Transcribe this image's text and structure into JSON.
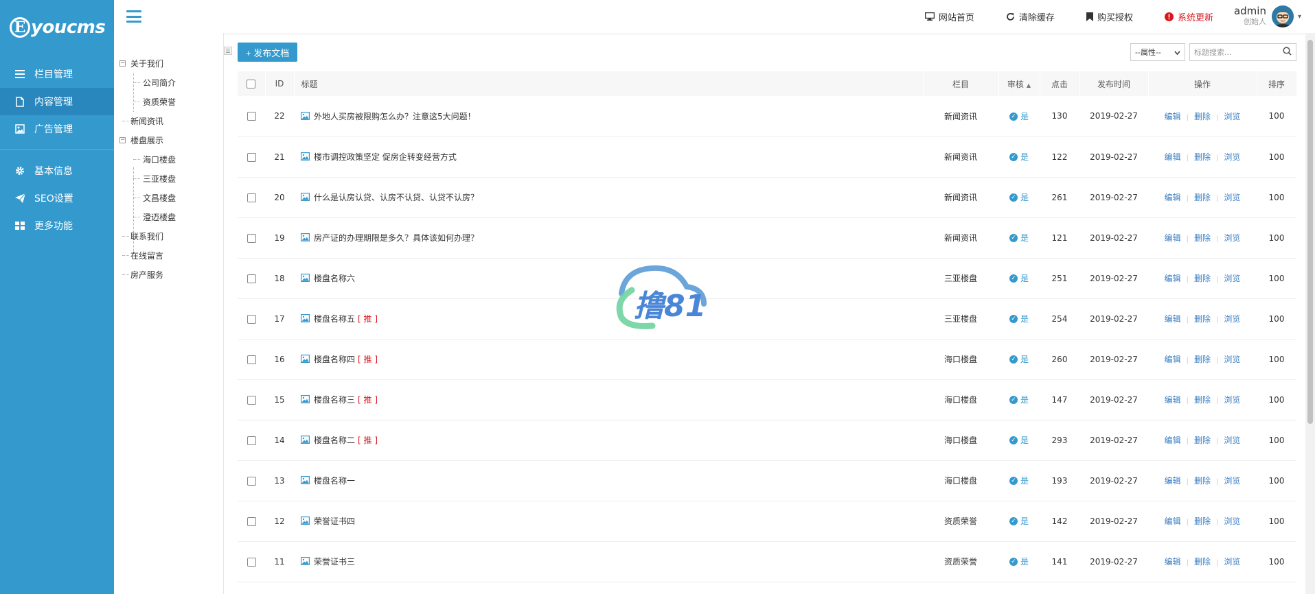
{
  "logo": {
    "letter": "E",
    "text": "youcms"
  },
  "sidebar": {
    "items": [
      {
        "label": "栏目管理",
        "icon": "list-icon"
      },
      {
        "label": "内容管理",
        "icon": "document-icon",
        "active": true
      },
      {
        "label": "广告管理",
        "icon": "image-icon"
      },
      {
        "label": "基本信息",
        "icon": "gear-icon"
      },
      {
        "label": "SEO设置",
        "icon": "paper-plane-icon"
      },
      {
        "label": "更多功能",
        "icon": "grid-icon"
      }
    ]
  },
  "topbar": {
    "links": [
      {
        "label": "网站首页",
        "icon": "monitor-icon"
      },
      {
        "label": "清除缓存",
        "icon": "refresh-icon"
      },
      {
        "label": "购买授权",
        "icon": "bookmark-icon"
      },
      {
        "label": "系统更新",
        "icon": "info-icon"
      }
    ],
    "user": {
      "name": "admin",
      "role": "创始人"
    }
  },
  "tree": {
    "items": [
      {
        "label": "关于我们",
        "level": 1,
        "toggle": "−"
      },
      {
        "label": "公司简介",
        "level": 2
      },
      {
        "label": "资质荣誉",
        "level": 2
      },
      {
        "label": "新闻资讯",
        "level": 1
      },
      {
        "label": "楼盘展示",
        "level": 1,
        "toggle": "−"
      },
      {
        "label": "海口楼盘",
        "level": 2
      },
      {
        "label": "三亚楼盘",
        "level": 2
      },
      {
        "label": "文昌楼盘",
        "level": 2
      },
      {
        "label": "澄迈楼盘",
        "level": 2
      },
      {
        "label": "联系我们",
        "level": 1
      },
      {
        "label": "在线留言",
        "level": 1
      },
      {
        "label": "房产服务",
        "level": 1
      }
    ]
  },
  "toolbar": {
    "add_label": "+ 发布文档",
    "attr_select": "--属性--",
    "search_placeholder": "标题搜索..."
  },
  "table": {
    "headers": {
      "id": "ID",
      "title": "标题",
      "column": "栏目",
      "audit": "审核",
      "clicks": "点击",
      "date": "发布时间",
      "ops": "操作",
      "sort": "排序"
    },
    "ops": {
      "edit": "编辑",
      "delete": "删除",
      "view": "浏览",
      "sep": "|"
    },
    "audit_yes": "是",
    "rec_tag": "[ 推 ]",
    "rows": [
      {
        "id": "22",
        "title": "外地人买房被限购怎么办？注意这5大问题！",
        "rec": false,
        "column": "新闻资讯",
        "clicks": "130",
        "date": "2019-02-27",
        "sort": "100"
      },
      {
        "id": "21",
        "title": "楼市调控政策坚定 促房企转变经营方式",
        "rec": false,
        "column": "新闻资讯",
        "clicks": "122",
        "date": "2019-02-27",
        "sort": "100"
      },
      {
        "id": "20",
        "title": "什么是认房认贷、认房不认贷、认贷不认房？",
        "rec": false,
        "column": "新闻资讯",
        "clicks": "261",
        "date": "2019-02-27",
        "sort": "100"
      },
      {
        "id": "19",
        "title": "房产证的办理期限是多久？具体该如何办理？",
        "rec": false,
        "column": "新闻资讯",
        "clicks": "121",
        "date": "2019-02-27",
        "sort": "100"
      },
      {
        "id": "18",
        "title": "楼盘名称六",
        "rec": false,
        "column": "三亚楼盘",
        "clicks": "251",
        "date": "2019-02-27",
        "sort": "100"
      },
      {
        "id": "17",
        "title": "楼盘名称五",
        "rec": true,
        "column": "三亚楼盘",
        "clicks": "254",
        "date": "2019-02-27",
        "sort": "100"
      },
      {
        "id": "16",
        "title": "楼盘名称四",
        "rec": true,
        "column": "海口楼盘",
        "clicks": "260",
        "date": "2019-02-27",
        "sort": "100"
      },
      {
        "id": "15",
        "title": "楼盘名称三",
        "rec": true,
        "column": "海口楼盘",
        "clicks": "147",
        "date": "2019-02-27",
        "sort": "100"
      },
      {
        "id": "14",
        "title": "楼盘名称二",
        "rec": true,
        "column": "海口楼盘",
        "clicks": "293",
        "date": "2019-02-27",
        "sort": "100"
      },
      {
        "id": "13",
        "title": "楼盘名称一",
        "rec": false,
        "column": "海口楼盘",
        "clicks": "193",
        "date": "2019-02-27",
        "sort": "100"
      },
      {
        "id": "12",
        "title": "荣誉证书四",
        "rec": false,
        "column": "资质荣誉",
        "clicks": "142",
        "date": "2019-02-27",
        "sort": "100"
      },
      {
        "id": "11",
        "title": "荣誉证书三",
        "rec": false,
        "column": "资质荣誉",
        "clicks": "141",
        "date": "2019-02-27",
        "sort": "100"
      }
    ]
  },
  "watermark": {
    "text": "撸81"
  },
  "colors": {
    "primary": "#3499cd",
    "active": "#2a87bd",
    "danger": "#d9161c",
    "link": "#3b7fc4"
  }
}
